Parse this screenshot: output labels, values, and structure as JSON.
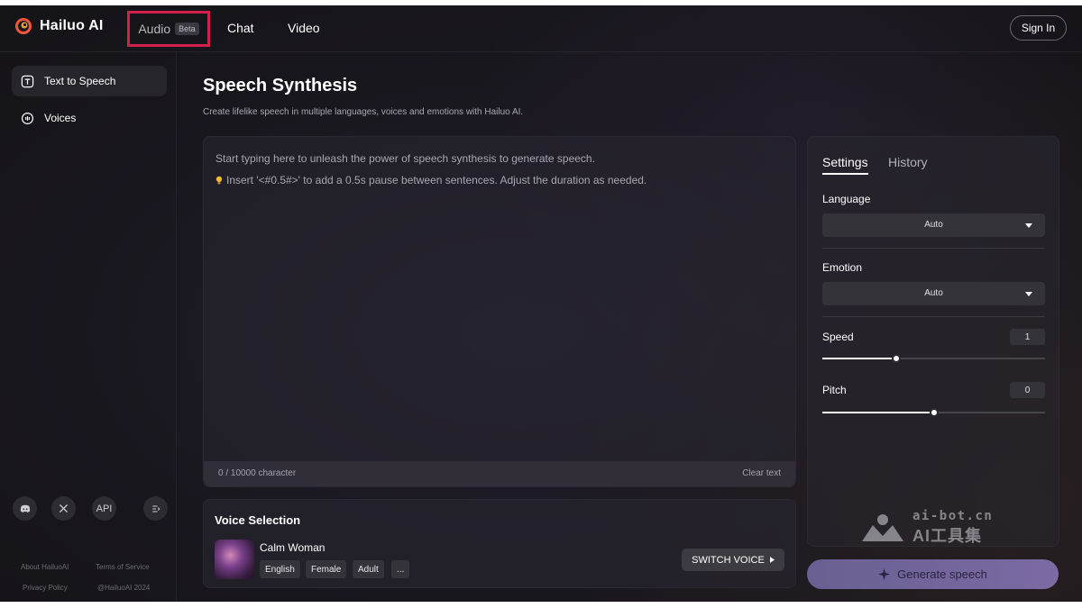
{
  "brand": {
    "name": "Hailuo AI"
  },
  "nav": {
    "audio": "Audio",
    "audio_badge": "Beta",
    "chat": "Chat",
    "video": "Video",
    "sign_in": "Sign In"
  },
  "sidebar": {
    "items": [
      {
        "label": "Text to Speech",
        "icon": "text-to-speech-icon",
        "active": true
      },
      {
        "label": "Voices",
        "icon": "voices-icon",
        "active": false
      }
    ],
    "social": {
      "api_label": "API"
    },
    "footer": {
      "about": "About HailuoAI",
      "terms": "Terms of Service",
      "privacy": "Privacy Policy",
      "copyright": "@HailuoAI 2024"
    }
  },
  "main": {
    "title": "Speech Synthesis",
    "subtitle": "Create lifelike speech in multiple languages, voices and emotions with Hailuo AI.",
    "editor": {
      "placeholder": "Start typing here to unleash the power of speech synthesis to generate speech.",
      "tip": "Insert '<#0.5#>' to add a 0.5s pause between sentences. Adjust the duration as needed.",
      "char_count": "0 / 10000 character",
      "clear_label": "Clear text"
    },
    "voice": {
      "section_title": "Voice Selection",
      "name": "Calm Woman",
      "tags": [
        "English",
        "Female",
        "Adult",
        "..."
      ],
      "switch_label": "SWITCH VOICE"
    }
  },
  "settings": {
    "tabs": [
      "Settings",
      "History"
    ],
    "language_label": "Language",
    "language_value": "Auto",
    "emotion_label": "Emotion",
    "emotion_value": "Auto",
    "speed_label": "Speed",
    "speed_value": "1",
    "speed_fraction": 0.33,
    "pitch_label": "Pitch",
    "pitch_value": "0",
    "pitch_fraction": 0.5
  },
  "generate_label": "Generate speech",
  "watermark": {
    "line1": "ai-bot.cn",
    "line2": "AI工具集"
  },
  "colors": {
    "highlight": "#d3204a",
    "generate_button": "#7b6aa3"
  }
}
